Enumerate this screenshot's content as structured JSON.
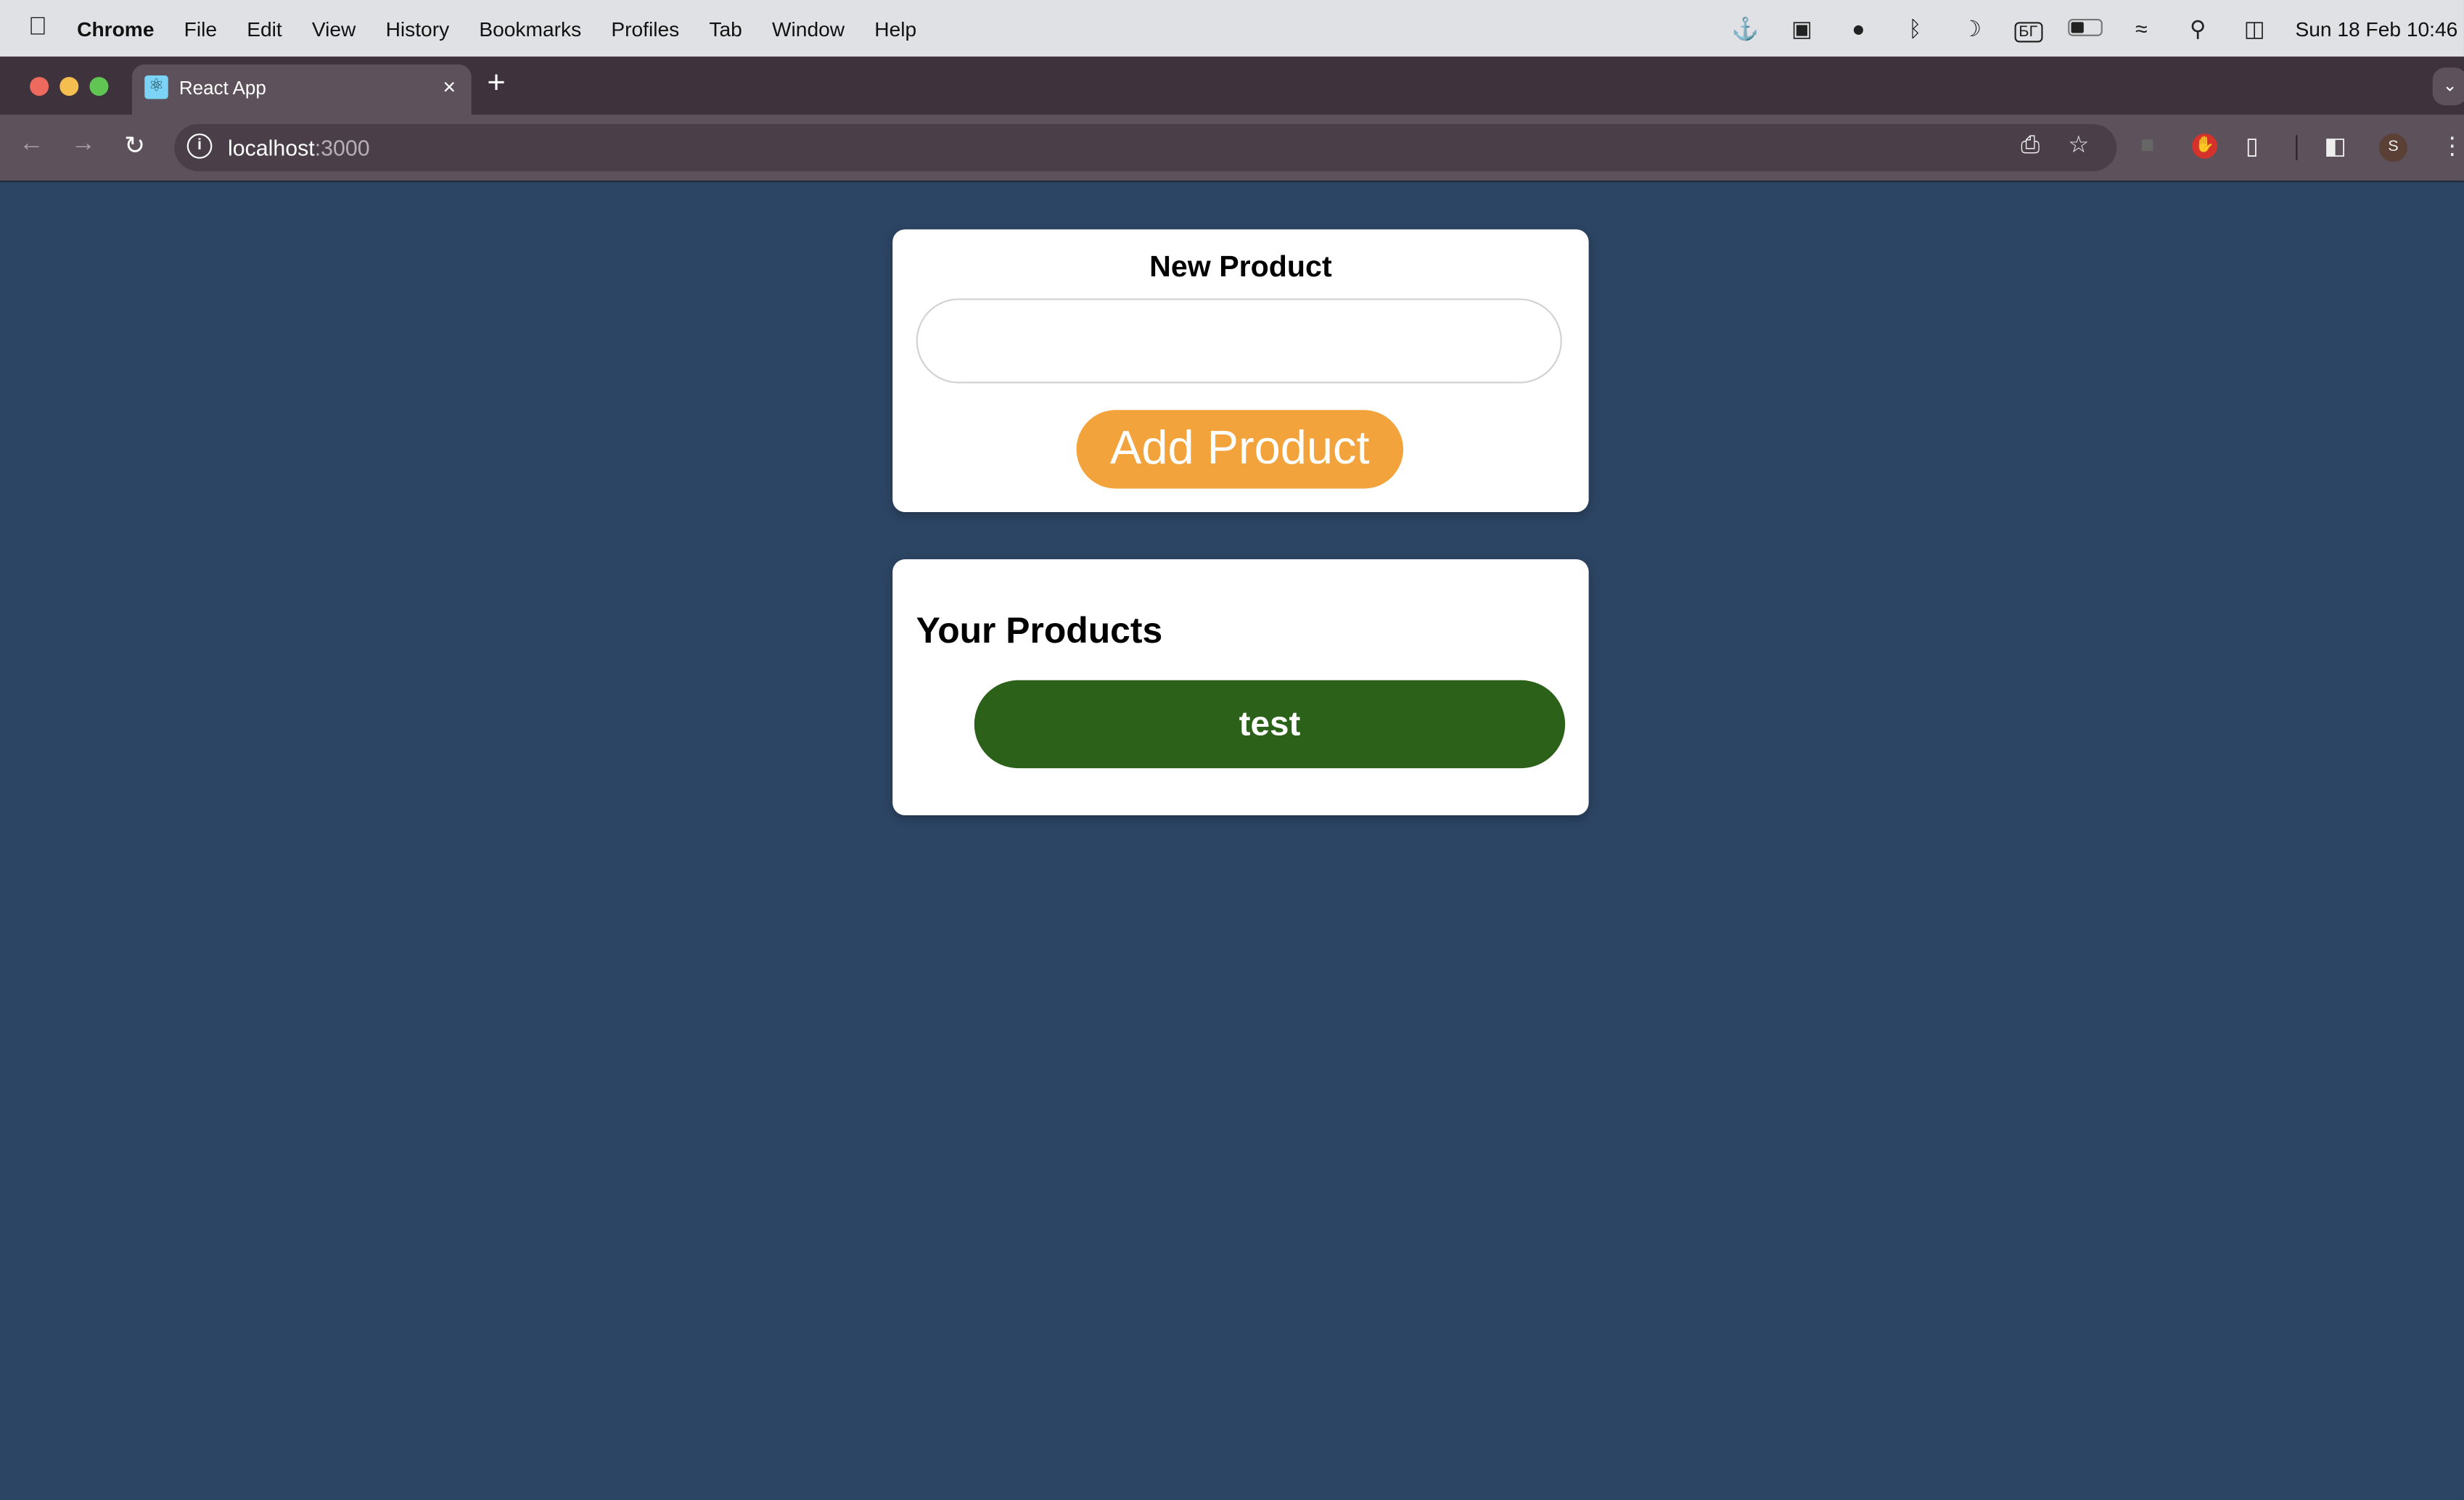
{
  "menubar": {
    "app": "Chrome",
    "items": [
      "File",
      "Edit",
      "View",
      "History",
      "Bookmarks",
      "Profiles",
      "Tab",
      "Window",
      "Help"
    ],
    "keyboard_layout": "БГ",
    "clock": "Sun 18 Feb  10:46",
    "status_icons": [
      "docker-icon",
      "window-icon",
      "bell-icon",
      "bluetooth-icon",
      "moon-icon",
      "keyboard-layout-icon",
      "battery-icon",
      "wifi-icon",
      "search-icon",
      "control-center-icon"
    ]
  },
  "browser": {
    "tab_title": "React App",
    "url_host": "localhost",
    "url_port": ":3000",
    "profile_initial": "S"
  },
  "new_product": {
    "title": "New Product",
    "input_value": "",
    "button_label": "Add Product"
  },
  "products": {
    "title": "Your Products",
    "items": [
      "test"
    ]
  },
  "colors": {
    "background": "#2c4564",
    "add_button": "#f2a33c",
    "product_button": "#2c6119"
  }
}
